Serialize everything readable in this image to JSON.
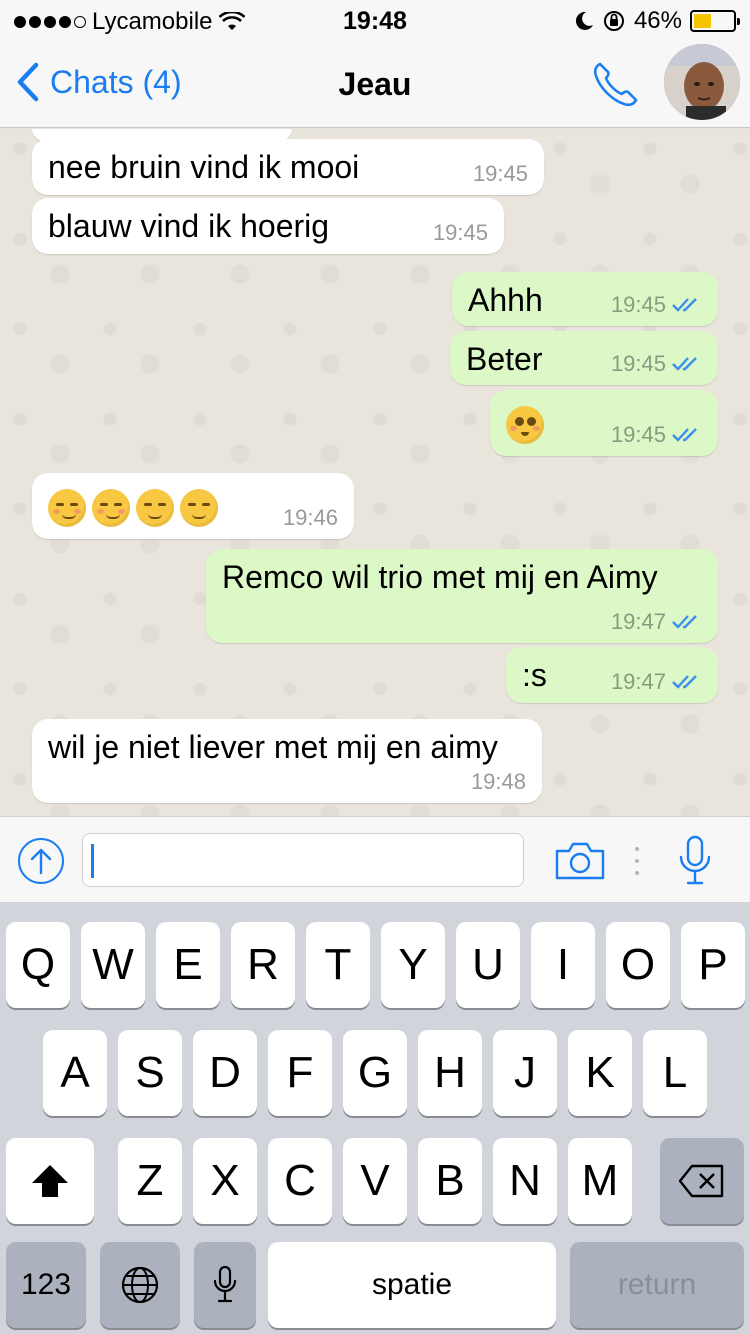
{
  "status_bar": {
    "carrier": "Lycamobile",
    "time": "19:48",
    "battery": "46%",
    "battery_level": 0.46,
    "signal_bars": 4
  },
  "nav": {
    "back_label": "Chats (4)",
    "title": "Jeau",
    "accent_color": "#1a7df1"
  },
  "messages": [
    {
      "dir": "in",
      "text": "nee bruin vind ik mooi",
      "time": "19:45"
    },
    {
      "dir": "in",
      "text": "blauw vind ik hoerig",
      "time": "19:45"
    },
    {
      "dir": "out",
      "text": "Ahhh",
      "time": "19:45",
      "status": "read"
    },
    {
      "dir": "out",
      "text": "Beter",
      "time": "19:45",
      "status": "read"
    },
    {
      "dir": "out",
      "emoji": [
        "flushed-face"
      ],
      "time": "19:45",
      "status": "read"
    },
    {
      "dir": "in",
      "emoji": [
        "smirking-face",
        "smirking-face",
        "relieved-face",
        "relieved-face"
      ],
      "time": "19:46"
    },
    {
      "dir": "out",
      "text": "Remco wil trio met mij en Aimy",
      "time": "19:47",
      "status": "read"
    },
    {
      "dir": "out",
      "text": ":s",
      "time": "19:47",
      "status": "read"
    },
    {
      "dir": "in",
      "text": "wil je niet liever met mij en aimy",
      "time": "19:48"
    }
  ],
  "input": {
    "value": "",
    "placeholder": ""
  },
  "keyboard": {
    "row1": [
      "Q",
      "W",
      "E",
      "R",
      "T",
      "Y",
      "U",
      "I",
      "O",
      "P"
    ],
    "row2": [
      "A",
      "S",
      "D",
      "F",
      "G",
      "H",
      "J",
      "K",
      "L"
    ],
    "row3": [
      "Z",
      "X",
      "C",
      "V",
      "B",
      "N",
      "M"
    ],
    "numbers_label": "123",
    "space_label": "spatie",
    "return_label": "return"
  },
  "icons": {
    "back": "chevron-left-icon",
    "call": "phone-icon",
    "share": "upload-arrow-icon",
    "camera": "camera-icon",
    "mic": "microphone-icon",
    "shift": "shift-arrow-icon",
    "delete": "backspace-icon",
    "globe": "globe-icon",
    "dictation": "microphone-icon",
    "read_ticks": "double-check-icon"
  }
}
